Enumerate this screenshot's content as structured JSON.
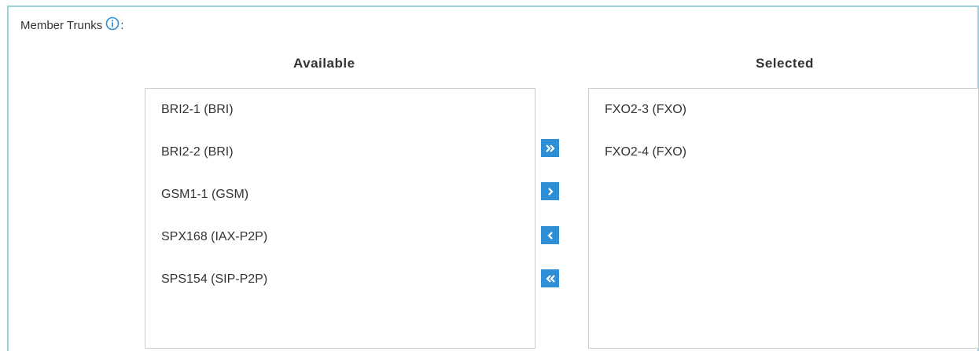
{
  "member_trunks": {
    "label": "Member Trunks",
    "colon": ":",
    "info_icon": "info-circle-icon"
  },
  "available": {
    "heading": "Available",
    "items": [
      "BRI2-1 (BRI)",
      "BRI2-2 (BRI)",
      "GSM1-1 (GSM)",
      "SPX168 (IAX-P2P)",
      "SPS154 (SIP-P2P)"
    ]
  },
  "selected": {
    "heading": "Selected",
    "items": [
      "FXO2-3 (FXO)",
      "FXO2-4 (FXO)"
    ]
  },
  "buttons": {
    "add_all_icon": "double-chevron-right-icon",
    "add_icon": "chevron-right-icon",
    "remove_icon": "chevron-left-icon",
    "remove_all_icon": "double-chevron-left-icon"
  },
  "colors": {
    "panel_border": "#9fd0dd",
    "button_bg": "#2f8fd6",
    "info_icon": "#2f8fd6"
  }
}
